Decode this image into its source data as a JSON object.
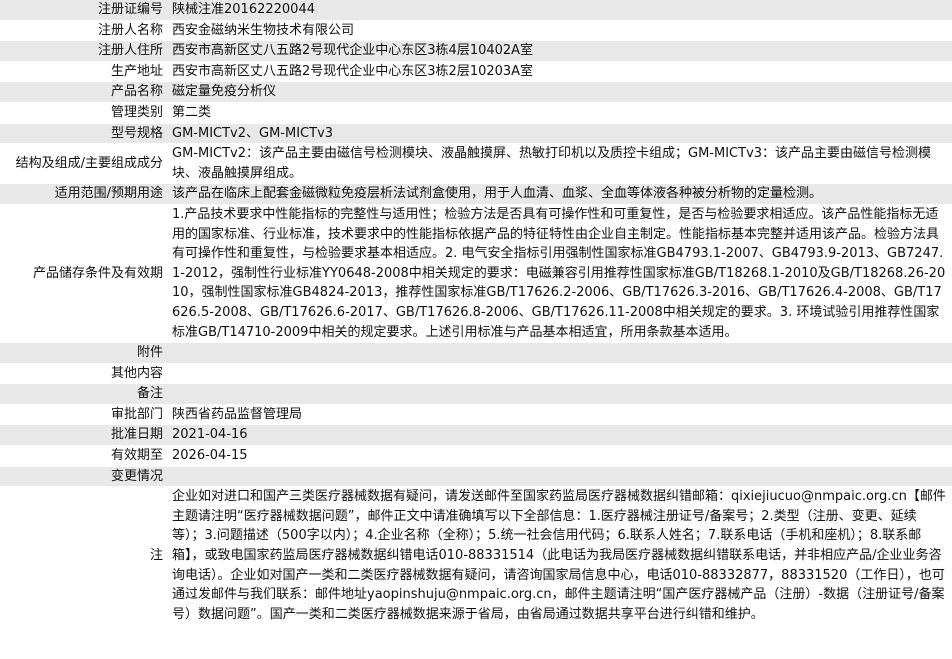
{
  "rows": [
    {
      "label": "注册证编号",
      "value": "陕械注准20162220044"
    },
    {
      "label": "注册人名称",
      "value": "西安金磁纳米生物技术有限公司"
    },
    {
      "label": "注册人住所",
      "value": "西安市高新区丈八五路2号现代企业中心东区3栋4层10402A室"
    },
    {
      "label": "生产地址",
      "value": "西安市高新区丈八五路2号现代企业中心东区3栋2层10203A室"
    },
    {
      "label": "产品名称",
      "value": "磁定量免疫分析仪"
    },
    {
      "label": "管理类别",
      "value": "第二类"
    },
    {
      "label": "型号规格",
      "value": "GM-MICTv2、GM-MICTv3"
    },
    {
      "label": "结构及组成/主要组成成分",
      "value": "GM-MICTv2：该产品主要由磁信号检测模块、液晶触摸屏、热敏打印机以及质控卡组成；GM-MICTv3：该产品主要由磁信号检测模块、液晶触摸屏组成。"
    },
    {
      "label": "适用范围/预期用途",
      "value": "该产品在临床上配套金磁微粒免疫层析法试剂盒使用，用于人血清、血浆、全血等体液各种被分析物的定量检测。"
    },
    {
      "label": "产品储存条件及有效期",
      "value": "1.产品技术要求中性能指标的完整性与适用性；检验方法是否具有可操作性和可重复性，是否与检验要求相适应。该产品性能指标无适用的国家标准、行业标准，技术要求中的性能指标依据产品的特征特性由企业自主制定。性能指标基本完整并适用该产品。检验方法具有可操作性和重复性，与检验要求基本相适应。2. 电气安全指标引用强制性国家标准GB4793.1-2007、GB4793.9-2013、GB7247.1-2012，强制性行业标准YY0648-2008中相关规定的要求：电磁兼容引用推荐性国家标准GB/T18268.1-2010及GB/T18268.26-2010，强制性国家标准GB4824-2013，推荐性国家标准GB/T17626.2-2006、GB/T17626.3-2016、GB/T17626.4-2008、GB/T17626.5-2008、GB/T17626.6-2017、GB/T17626.8-2006、GB/T17626.11-2008中相关规定的要求。3. 环境试验引用推荐性国家标准GB/T14710-2009中相关的规定要求。上述引用标准与产品基本相适宜，所用条款基本适用。"
    },
    {
      "label": "附件",
      "value": ""
    },
    {
      "label": "其他内容",
      "value": ""
    },
    {
      "label": "备注",
      "value": ""
    },
    {
      "label": "审批部门",
      "value": "陕西省药品监督管理局"
    },
    {
      "label": "批准日期",
      "value": "2021-04-16"
    },
    {
      "label": "有效期至",
      "value": "2026-04-15"
    },
    {
      "label": "变更情况",
      "value": ""
    },
    {
      "label": "注",
      "value": "企业如对进口和国产三类医疗器械数据有疑问，请发送邮件至国家药监局医疗器械数据纠错邮箱：qixiejiucuo@nmpaic.org.cn【邮件主题请注明“医疗器械数据问题”，邮件正文中请准确填写以下全部信息：1.医疗器械注册证号/备案号；2.类型（注册、变更、延续等）；3.问题描述（500字以内）；4.企业名称（全称）；5.统一社会信用代码；6.联系人姓名；7.联系电话（手机和座机）；8.联系邮箱】，或致电国家药监局医疗器械数据纠错电话010-88331514（此电话为我局医疗器械数据纠错联系电话，并非相应产品/企业业务咨询电话）。企业如对国产一类和二类医疗器械数据有疑问，请咨询国家局信息中心，电话010-88332877，88331520（工作日），也可通过发邮件与我们联系：邮件地址yaopinshuju@nmpaic.org.cn，邮件主题请注明“国产医疗器械产品（注册）-数据（注册证号/备案号）数据问题”。国产一类和二类医疗器械数据来源于省局，由省局通过数据共享平台进行纠错和维护。"
    }
  ]
}
